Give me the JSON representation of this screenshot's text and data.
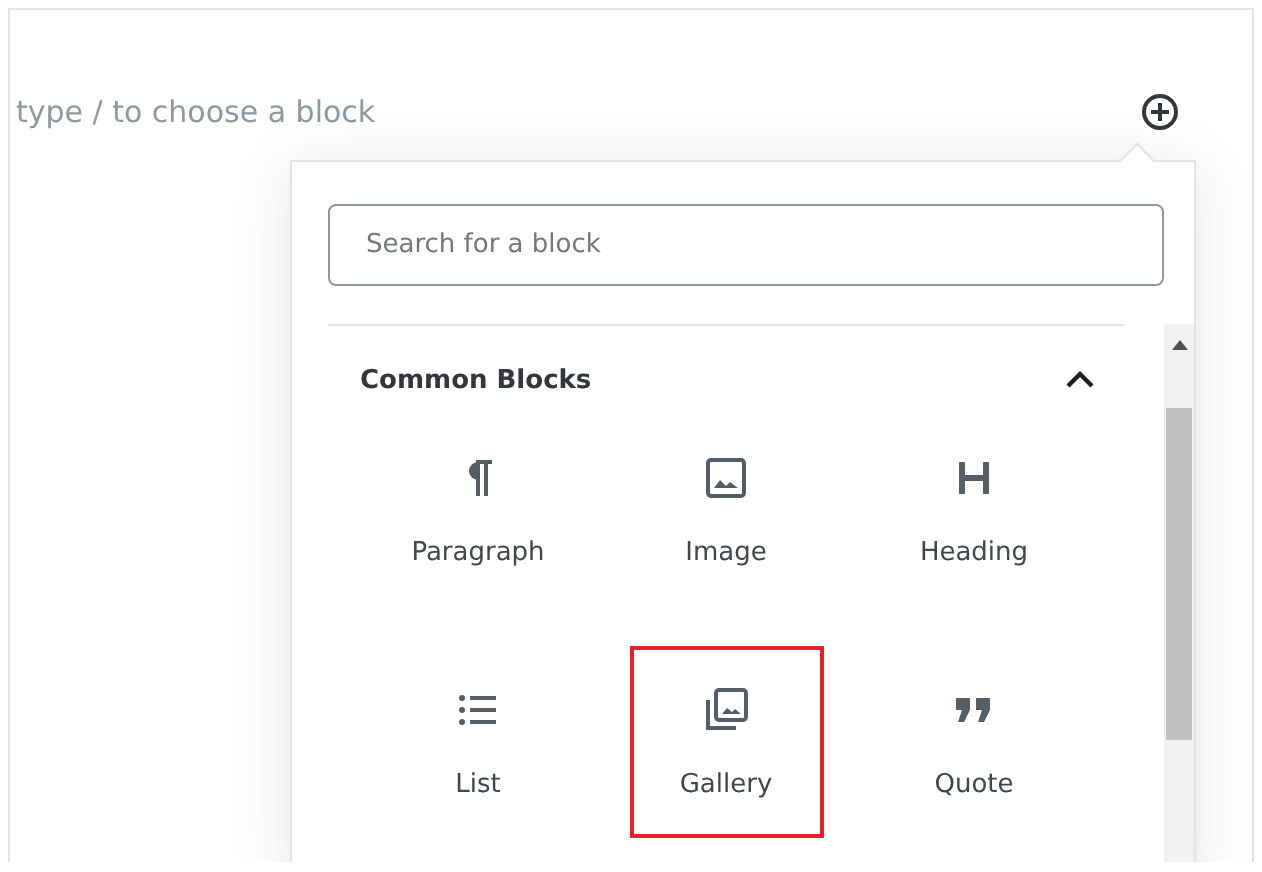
{
  "editor": {
    "hint": "type / to choose a block"
  },
  "inserter": {
    "search": {
      "placeholder": "Search for a block"
    },
    "section": {
      "title": "Common Blocks",
      "expanded": true
    },
    "blocks": [
      {
        "label": "Paragraph",
        "kind": "paragraph",
        "highlighted": false
      },
      {
        "label": "Image",
        "kind": "image",
        "highlighted": false
      },
      {
        "label": "Heading",
        "kind": "heading",
        "highlighted": false
      },
      {
        "label": "List",
        "kind": "list",
        "highlighted": false
      },
      {
        "label": "Gallery",
        "kind": "gallery",
        "highlighted": true
      },
      {
        "label": "Quote",
        "kind": "quote",
        "highlighted": false
      }
    ]
  }
}
